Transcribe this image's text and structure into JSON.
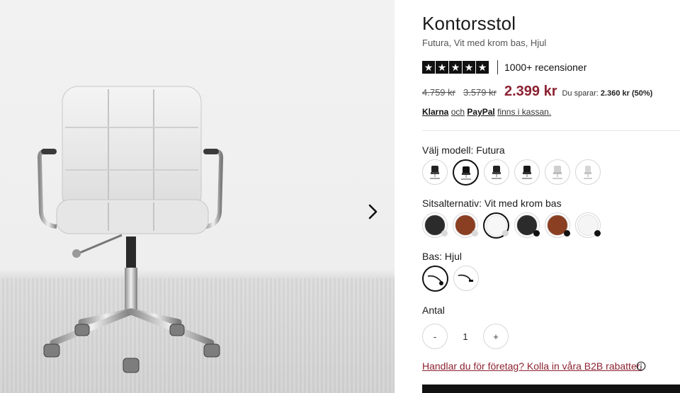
{
  "product": {
    "title": "Kontorsstol",
    "subtitle": "Futura, Vit med krom bas, Hjul",
    "rating": {
      "stars": 5,
      "max": 5,
      "reviews_text": "1000+ recensioner"
    },
    "prices": {
      "original": "4.759 kr",
      "previous": "3.579 kr",
      "current": "2.399 kr",
      "savings_label": "Du sparar:",
      "savings_value": "2.360 kr (50%)"
    },
    "payment": {
      "klarna": "Klarna",
      "och": "och",
      "paypal": "PayPal",
      "suffix": "finns i kassan."
    }
  },
  "options": {
    "model": {
      "label": "Välj modell: Futura",
      "selected_index": 1,
      "swatches": [
        "chair-model-1-icon",
        "chair-model-2-icon",
        "chair-model-3-icon",
        "chair-model-4-icon",
        "chair-model-5-icon",
        "chair-model-6-icon"
      ]
    },
    "seat": {
      "label": "Sitsalternativ: Vit med krom bas",
      "selected_index": 2,
      "swatches": [
        {
          "fill": "#2b2b2b",
          "dot": "#d9d9d9"
        },
        {
          "fill": "#8a3f22",
          "dot": "#d9d9d9"
        },
        {
          "fill": "#f7f7f7",
          "dot": "#d9d9d9"
        },
        {
          "fill": "#2b2b2b",
          "dot": "#111111"
        },
        {
          "fill": "#8a3f22",
          "dot": "#111111"
        },
        {
          "fill": "#f5f5f5",
          "dot": "#111111"
        }
      ]
    },
    "base": {
      "label": "Bas: Hjul",
      "selected_index": 0,
      "swatches": [
        "wheel-base-icon",
        "glide-base-icon"
      ]
    }
  },
  "quantity": {
    "label": "Antal",
    "minus": "-",
    "value": "1",
    "plus": "+"
  },
  "b2b_link": "Handlar du för företag? Kolla in våra B2B rabatter.",
  "icons": {
    "next": "chevron-right-icon",
    "info": "info-icon",
    "star": "star-icon"
  },
  "colors": {
    "accent": "#8c2232",
    "text": "#111111"
  }
}
